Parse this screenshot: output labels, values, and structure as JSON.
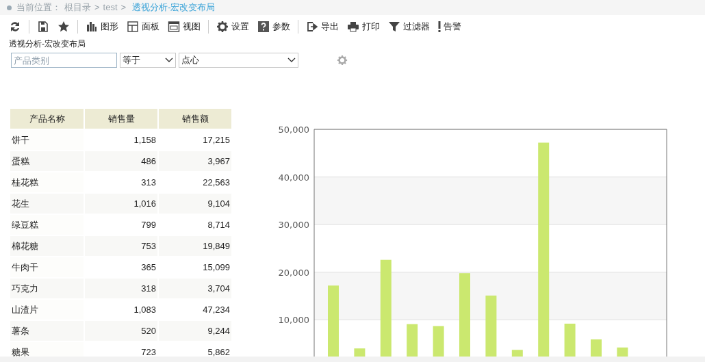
{
  "breadcrumb": {
    "label": "当前位置：",
    "items": [
      {
        "kind": "link",
        "text": "根目录"
      },
      {
        "kind": "separator",
        "text": ">"
      },
      {
        "kind": "link",
        "text": "test"
      },
      {
        "kind": "separator",
        "text": ">"
      },
      {
        "kind": "current",
        "text": "透视分析-宏改变布局"
      }
    ]
  },
  "toolbar": [
    {
      "kind": "button"
    },
    {
      "kind": "separator"
    },
    {
      "kind": "button"
    },
    {
      "kind": "button"
    },
    {
      "kind": "separator"
    },
    {
      "kind": "button",
      "label": "图形"
    },
    {
      "kind": "button",
      "label": "面板"
    },
    {
      "kind": "button",
      "label": "视图"
    },
    {
      "kind": "separator"
    },
    {
      "kind": "button",
      "label": "设置"
    },
    {
      "kind": "button",
      "label": "参数"
    },
    {
      "kind": "separator"
    },
    {
      "kind": "button",
      "label": "导出"
    },
    {
      "kind": "button",
      "label": "打印"
    },
    {
      "kind": "button",
      "label": "过滤器"
    },
    {
      "kind": "button",
      "label": "告警"
    }
  ],
  "report_title": "透视分析-宏改变布局",
  "filter": {
    "field": {
      "placeholder": "产品类别"
    },
    "operator": "等于",
    "value": "点心"
  },
  "table": {
    "columns": [
      "产品名称",
      "销售量",
      "销售额"
    ],
    "rows": [
      [
        "饼干",
        "1,158",
        "17,215"
      ],
      [
        "蛋糕",
        "486",
        "3,967"
      ],
      [
        "桂花糕",
        "313",
        "22,563"
      ],
      [
        "花生",
        "1,016",
        "9,104"
      ],
      [
        "绿豆糕",
        "799",
        "8,714"
      ],
      [
        "棉花糖",
        "753",
        "19,849"
      ],
      [
        "牛肉干",
        "365",
        "15,099"
      ],
      [
        "巧克力",
        "318",
        "3,704"
      ],
      [
        "山渣片",
        "1,083",
        "47,234"
      ],
      [
        "薯条",
        "520",
        "9,244"
      ],
      [
        "糖果",
        "723",
        "5,862"
      ]
    ]
  },
  "chart": {
    "chart_data": {
      "type": "bar",
      "grid": true,
      "ylim": [
        0,
        50000
      ],
      "yticks": [
        {
          "value": 10000,
          "label": "10,000"
        },
        {
          "value": 20000,
          "label": "20,000"
        },
        {
          "value": 30000,
          "label": "30,000"
        },
        {
          "value": 40000,
          "label": "40,000"
        },
        {
          "value": 50000,
          "label": "50,000"
        }
      ],
      "series": [
        {
          "color": "#cbe86f",
          "values": [
            17200,
            4000,
            22600,
            9100,
            8700,
            19800,
            15100,
            3700,
            47200,
            9200,
            5900,
            4200
          ]
        }
      ]
    }
  }
}
